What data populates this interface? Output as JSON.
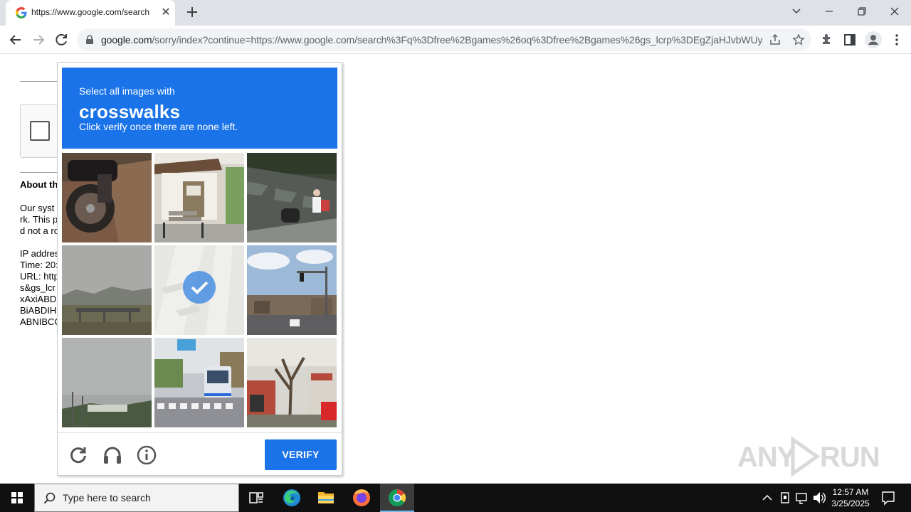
{
  "browser": {
    "tab_title": "https://www.google.com/search",
    "url_host": "google.com",
    "url_path": "/sorry/index?continue=https://www.google.com/search%3Fq%3Dfree%2Bgames%26oq%3Dfree%2Bgames%26gs_lcrp%3DEgZjaHJvbWUy..."
  },
  "sorry_page": {
    "heading": "About th",
    "paragraph_lines": [
      "Our syst",
      "rk. This p",
      "d not a ro"
    ],
    "info_lines": [
      "IP addres",
      "Time: 20:",
      "URL: http",
      "s&gs_lcr",
      "xAxiABD",
      "BiABDIH",
      "ABNIBCC"
    ]
  },
  "captcha": {
    "desc": "Select all images with",
    "target": "crosswalks",
    "instruction": "Click verify once there are none left.",
    "verify_label": "VERIFY",
    "selected_tile": 4,
    "tiles": [
      "motorcycle",
      "storefront",
      "stone-wall-road",
      "bridge-landscape",
      "crosswalk-faded",
      "street-traffic-lights",
      "highway-sky",
      "bus-crosswalk",
      "tree-houses"
    ]
  },
  "watermark": "ANY RUN",
  "taskbar": {
    "search_placeholder": "Type here to search",
    "time": "12:57 AM",
    "date": "3/25/2025"
  },
  "colors": {
    "accent": "#1a73e8",
    "taskbar": "#101010",
    "tabstrip": "#dee1e6"
  }
}
